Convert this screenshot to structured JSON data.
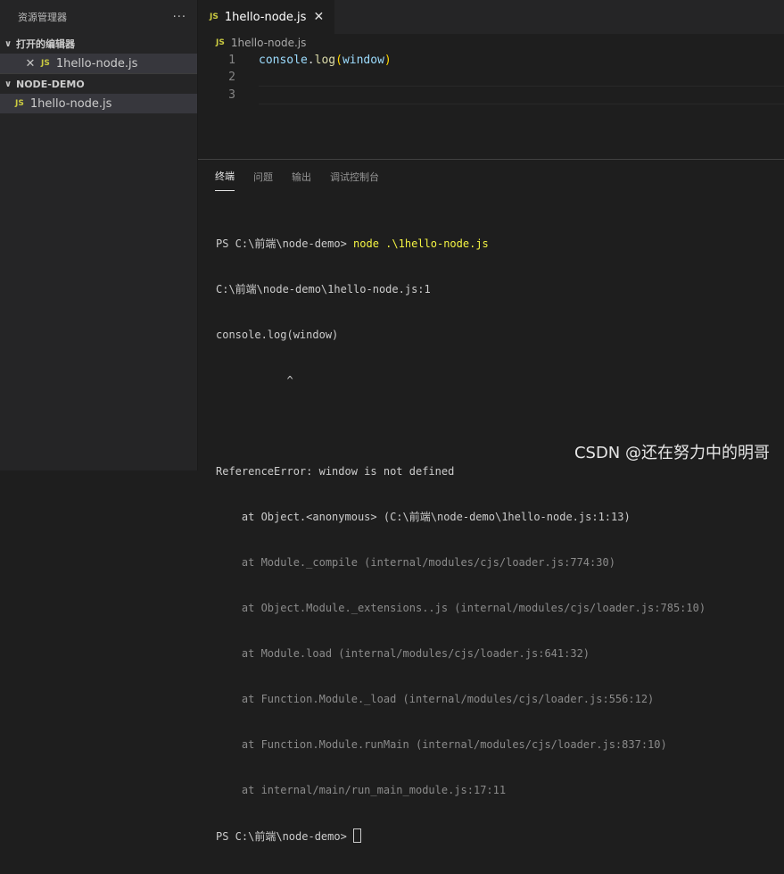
{
  "explorer": {
    "title": "资源管理器",
    "more_icon": "ellipsis-icon",
    "open_editors": {
      "label": "打开的编辑器",
      "files": [
        {
          "badge": "JS",
          "name": "1hello-node.js"
        }
      ]
    },
    "project": {
      "label": "NODE-DEMO",
      "files": [
        {
          "badge": "JS",
          "name": "1hello-node.js"
        }
      ]
    }
  },
  "editor": {
    "tab": {
      "badge": "JS",
      "name": "1hello-node.js"
    },
    "breadcrumb": {
      "badge": "JS",
      "name": "1hello-node.js"
    },
    "line_numbers": [
      "1",
      "2",
      "3"
    ],
    "line1": {
      "obj": "console",
      "dot": ".",
      "fn": "log",
      "open": "(",
      "arg": "window",
      "close": ")"
    }
  },
  "panel": {
    "tabs": [
      "终端",
      "问题",
      "输出",
      "调试控制台"
    ],
    "terminal": {
      "prompt": "PS C:\\前端\\node-demo> ",
      "command": "node .\\1hello-node.js",
      "lines": [
        "C:\\前端\\node-demo\\1hello-node.js:1",
        "console.log(window)",
        "           ^",
        "",
        "ReferenceError: window is not defined",
        "    at Object.<anonymous> (C:\\前端\\node-demo\\1hello-node.js:1:13)"
      ],
      "stack": [
        "    at Module._compile (internal/modules/cjs/loader.js:774:30)",
        "    at Object.Module._extensions..js (internal/modules/cjs/loader.js:785:10)",
        "    at Module.load (internal/modules/cjs/loader.js:641:32)",
        "    at Function.Module._load (internal/modules/cjs/loader.js:556:12)",
        "    at Function.Module.runMain (internal/modules/cjs/loader.js:837:10)",
        "    at internal/main/run_main_module.js:17:11"
      ],
      "final_prompt": "PS C:\\前端\\node-demo> "
    }
  },
  "watermark": "CSDN @还在努力中的明哥",
  "colors": {
    "js_badge": "#cbcb41",
    "command": "#f5f543",
    "background": "#1e1e1e"
  }
}
